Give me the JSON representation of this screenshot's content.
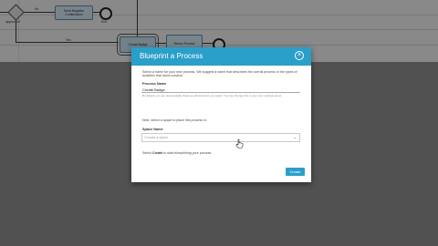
{
  "modal": {
    "title": "Blueprint a Process",
    "intro": "Select a name for your new process. We suggest a name that describes the overall process or the types of activities that users conduct.",
    "process_name_label": "Process Name",
    "process_name_value": "Create Badge",
    "helper": "By default, you are automatically listed as administrator you select. You can change this in your user settings panel.",
    "space_intro": "Next, select a space to place this process in.",
    "space_name_label": "Space Name",
    "space_placeholder": "Choose a space",
    "create_hint_pre": "Select ",
    "create_hint_bold": "Create",
    "create_hint_post": " to start blueprinting your process.",
    "create_label": "Create",
    "close_glyph": "×",
    "chevron_glyph": "⌄"
  },
  "diagram": {
    "tasks": [
      {
        "label": "Send Negative Confirmation"
      },
      {
        "label": "Create Badge"
      },
      {
        "label": "Return Product"
      }
    ],
    "labels": {
      "no": "No",
      "yes": "Yes",
      "end": "End",
      "approved": "Approved?"
    }
  },
  "colors": {
    "accent": "#2a9fc9",
    "task_fill": "#cfe3ec",
    "diagram_bg": "#ececec",
    "overlay": "#8c8c8c"
  }
}
